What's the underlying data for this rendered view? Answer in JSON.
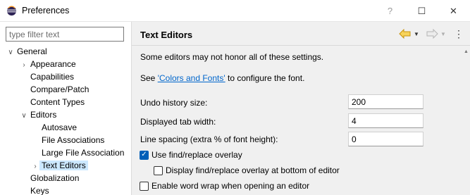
{
  "window": {
    "title": "Preferences",
    "help_glyph": "?",
    "maximize_glyph": "☐",
    "close_glyph": "✕"
  },
  "left": {
    "filter_placeholder": "type filter text",
    "tree": [
      {
        "label": "General",
        "expanded": true,
        "level": 0
      },
      {
        "label": "Appearance",
        "expanded": false,
        "has_children": true,
        "level": 1
      },
      {
        "label": "Capabilities",
        "level": 1
      },
      {
        "label": "Compare/Patch",
        "level": 1
      },
      {
        "label": "Content Types",
        "level": 1
      },
      {
        "label": "Editors",
        "expanded": true,
        "level": 1
      },
      {
        "label": "Autosave",
        "level": 2
      },
      {
        "label": "File Associations",
        "level": 2
      },
      {
        "label": "Large File Association",
        "level": 2
      },
      {
        "label": "Text Editors",
        "expanded": false,
        "has_children": true,
        "level": 2,
        "selected": true
      },
      {
        "label": "Globalization",
        "level": 1
      },
      {
        "label": "Keys",
        "level": 1
      }
    ]
  },
  "right": {
    "title": "Text Editors",
    "info": "Some editors may not honor all of these settings.",
    "see_prefix": "See ",
    "see_link": "'Colors and Fonts'",
    "see_suffix": " to configure the font.",
    "fields": [
      {
        "label": "Undo history size:",
        "value": "200"
      },
      {
        "label": "Displayed tab width:",
        "value": "4"
      },
      {
        "label": "Line spacing (extra % of font height):",
        "value": "0"
      }
    ],
    "checkboxes": [
      {
        "label": "Use find/replace overlay",
        "checked": true
      },
      {
        "label": "Display find/replace overlay at bottom of editor",
        "checked": false
      },
      {
        "label": "Enable word wrap when opening an editor",
        "checked": false
      }
    ]
  },
  "colors": {
    "accent": "#005fb8",
    "link": "#0066cc",
    "selection": "#cce8ff",
    "nav_arrow": "#e8a317"
  }
}
